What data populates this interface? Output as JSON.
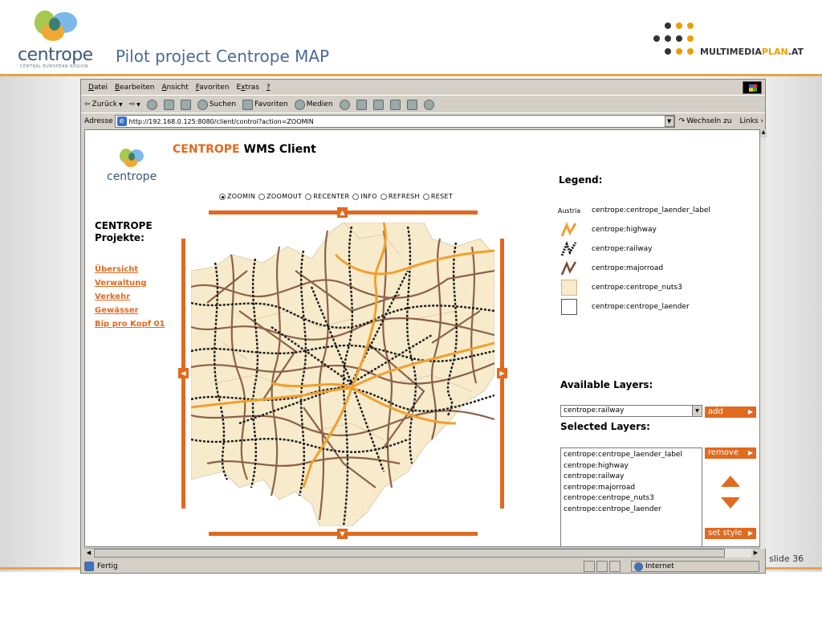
{
  "slide": {
    "title": "Pilot project Centrope MAP",
    "logo_text": "centrope",
    "logo_subtitle": "CENTRAL EUROPEAN REGION",
    "partner_logo": {
      "text_main": "MULTIMEDIA",
      "text_accent": "PLAN",
      "text_suffix": ".AT"
    },
    "slide_number": "slide 36",
    "accent_color": "#e8a24a"
  },
  "browser": {
    "menu": [
      "Datei",
      "Bearbeiten",
      "Ansicht",
      "Favoriten",
      "Extras",
      "?"
    ],
    "toolbar": {
      "back": "Zurück",
      "search": "Suchen",
      "favorites": "Favoriten",
      "media": "Medien"
    },
    "address_label": "Adresse",
    "address_url": "http://192.168.0.125:8080/client/control?action=ZOOMIN",
    "go_label": "Wechseln zu",
    "links_label": "Links",
    "status_text": "Fertig",
    "zone_text": "Internet"
  },
  "app": {
    "logo_text": "centrope",
    "title_accent": "CENTROPE",
    "title_rest": "WMS Client",
    "tools": [
      "ZOOMIN",
      "ZOOMOUT",
      "RECENTER",
      "INFO",
      "REFRESH",
      "RESET"
    ],
    "selected_tool": "ZOOMIN",
    "projects_title_1": "CENTROPE",
    "projects_title_2": "Projekte:",
    "project_links": [
      "Übersicht",
      "Verwaltung",
      "Verkehr",
      "Gewässer",
      "Bip pro Kopf 01"
    ],
    "legend_title": "Legend:",
    "legend": [
      {
        "symbol": "Austria",
        "label": "centrope:centrope_laender_label"
      },
      {
        "symbol": "highway-icon",
        "label": "centrope:highway"
      },
      {
        "symbol": "railway-icon",
        "label": "centrope:railway"
      },
      {
        "symbol": "majorroad-icon",
        "label": "centrope:majorroad"
      },
      {
        "symbol": "nuts3-swatch",
        "label": "centrope:centrope_nuts3"
      },
      {
        "symbol": "laender-swatch",
        "label": "centrope:centrope_laender"
      }
    ],
    "available_title": "Available Layers:",
    "available_selected": "centrope:railway",
    "add_label": "add",
    "selected_title": "Selected Layers:",
    "selected_layers": [
      "centrope:centrope_laender_label",
      "centrope:highway",
      "centrope:railway",
      "centrope:majorroad",
      "centrope:centrope_nuts3",
      "centrope:centrope_laender"
    ],
    "remove_label": "remove",
    "set_style_label": "set style",
    "colors": {
      "accent": "#e06a20",
      "map_fill": "#f7ebcb",
      "highway": "#f0a030",
      "majorroad": "#7a4a30"
    }
  }
}
